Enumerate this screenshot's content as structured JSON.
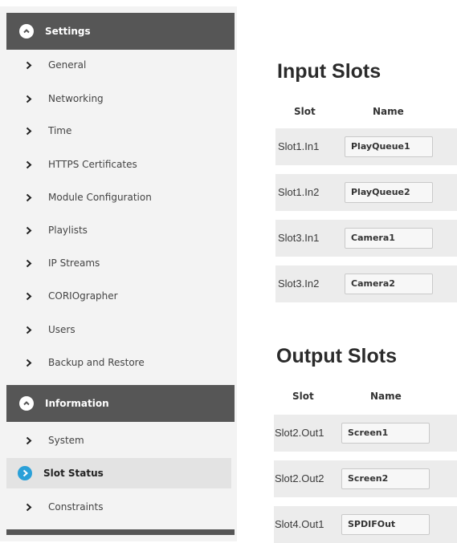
{
  "colors": {
    "header_bg": "#565656",
    "sidebar_bg": "#f3f3f3",
    "active_bg": "#e3e3e3",
    "active_icon": "#2aa0d8",
    "row_bg": "#ececec"
  },
  "sidebar": {
    "settings_header": {
      "label": "Settings",
      "icon": "chevron-up-circle-icon"
    },
    "settings_items": [
      {
        "label": "General",
        "icon": "chevron-right-icon"
      },
      {
        "label": "Networking",
        "icon": "chevron-right-icon"
      },
      {
        "label": "Time",
        "icon": "chevron-right-icon"
      },
      {
        "label": "HTTPS Certificates",
        "icon": "chevron-right-icon"
      },
      {
        "label": "Module Configuration",
        "icon": "chevron-right-icon"
      },
      {
        "label": "Playlists",
        "icon": "chevron-right-icon"
      },
      {
        "label": "IP Streams",
        "icon": "chevron-right-icon"
      },
      {
        "label": "CORIOgrapher",
        "icon": "chevron-right-icon"
      },
      {
        "label": "Users",
        "icon": "chevron-right-icon"
      },
      {
        "label": "Backup and Restore",
        "icon": "chevron-right-icon"
      }
    ],
    "information_header": {
      "label": "Information",
      "icon": "chevron-up-circle-icon"
    },
    "information_items": [
      {
        "label": "System",
        "icon": "chevron-right-icon",
        "active": false
      },
      {
        "label": "Slot Status",
        "icon": "chevron-right-circle-icon",
        "active": true
      },
      {
        "label": "Constraints",
        "icon": "chevron-right-icon",
        "active": false
      }
    ]
  },
  "main": {
    "input_title": "Input Slots",
    "input_columns": {
      "slot": "Slot",
      "name": "Name"
    },
    "input_rows": [
      {
        "slot": "Slot1.In1",
        "name": "PlayQueue1"
      },
      {
        "slot": "Slot1.In2",
        "name": "PlayQueue2"
      },
      {
        "slot": "Slot3.In1",
        "name": "Camera1"
      },
      {
        "slot": "Slot3.In2",
        "name": "Camera2"
      }
    ],
    "output_title": "Output Slots",
    "output_columns": {
      "slot": "Slot",
      "name": "Name"
    },
    "output_rows": [
      {
        "slot": "Slot2.Out1",
        "name": "Screen1"
      },
      {
        "slot": "Slot2.Out2",
        "name": "Screen2"
      },
      {
        "slot": "Slot4.Out1",
        "name": "SPDIFOut"
      }
    ]
  }
}
